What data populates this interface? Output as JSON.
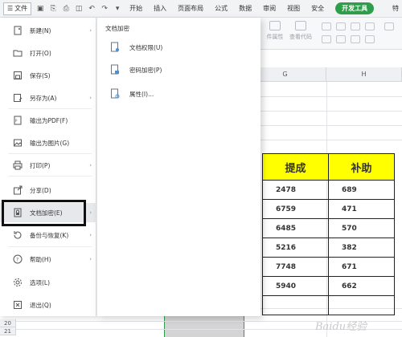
{
  "menubar": {
    "file_label": "文件",
    "tabs": [
      "开始",
      "插入",
      "页面布局",
      "公式",
      "数据",
      "审阅",
      "视图",
      "安全"
    ],
    "active_tab": "开发工具",
    "more": "特"
  },
  "ribbon": {
    "items": [
      "件属性",
      "查看代码"
    ]
  },
  "sheet": {
    "columns": [
      "G",
      "H"
    ],
    "rows": [
      "20",
      "21"
    ],
    "table": {
      "headers": [
        "提成",
        "补助"
      ],
      "rows": [
        [
          "2478",
          "689"
        ],
        [
          "6759",
          "471"
        ],
        [
          "6485",
          "570"
        ],
        [
          "5216",
          "382"
        ],
        [
          "7748",
          "671"
        ],
        [
          "5940",
          "662"
        ],
        [
          "",
          ""
        ]
      ]
    }
  },
  "file_menu": {
    "items": [
      {
        "label": "新建(N)",
        "icon": "new-file-icon",
        "arrow": true
      },
      {
        "label": "打开(O)",
        "icon": "folder-open-icon",
        "arrow": false
      },
      {
        "label": "保存(S)",
        "icon": "save-icon",
        "arrow": false
      },
      {
        "label": "另存为(A)",
        "icon": "save-as-icon",
        "arrow": true
      },
      {
        "label": "输出为PDF(F)",
        "icon": "pdf-icon",
        "arrow": false
      },
      {
        "label": "输出为图片(G)",
        "icon": "image-export-icon",
        "arrow": false
      },
      {
        "label": "打印(P)",
        "icon": "print-icon",
        "arrow": true
      },
      {
        "label": "分享(D)",
        "icon": "share-icon",
        "arrow": false
      },
      {
        "label": "文档加密(E)",
        "icon": "document-encrypt-icon",
        "arrow": true
      },
      {
        "label": "备份与恢复(K)",
        "icon": "backup-icon",
        "arrow": true
      },
      {
        "label": "帮助(H)",
        "icon": "help-icon",
        "arrow": true
      },
      {
        "label": "选项(L)",
        "icon": "gear-icon",
        "arrow": false
      },
      {
        "label": "退出(Q)",
        "icon": "exit-icon",
        "arrow": false
      }
    ]
  },
  "submenu": {
    "title": "文档加密",
    "items": [
      "文档权限(U)",
      "密码加密(P)",
      "属性(I)..."
    ]
  },
  "watermark": "Baidu经验",
  "colors": {
    "accent": "#2e9e4a",
    "header_fill": "#ffff00",
    "selected_column": "#d4d4d4"
  }
}
